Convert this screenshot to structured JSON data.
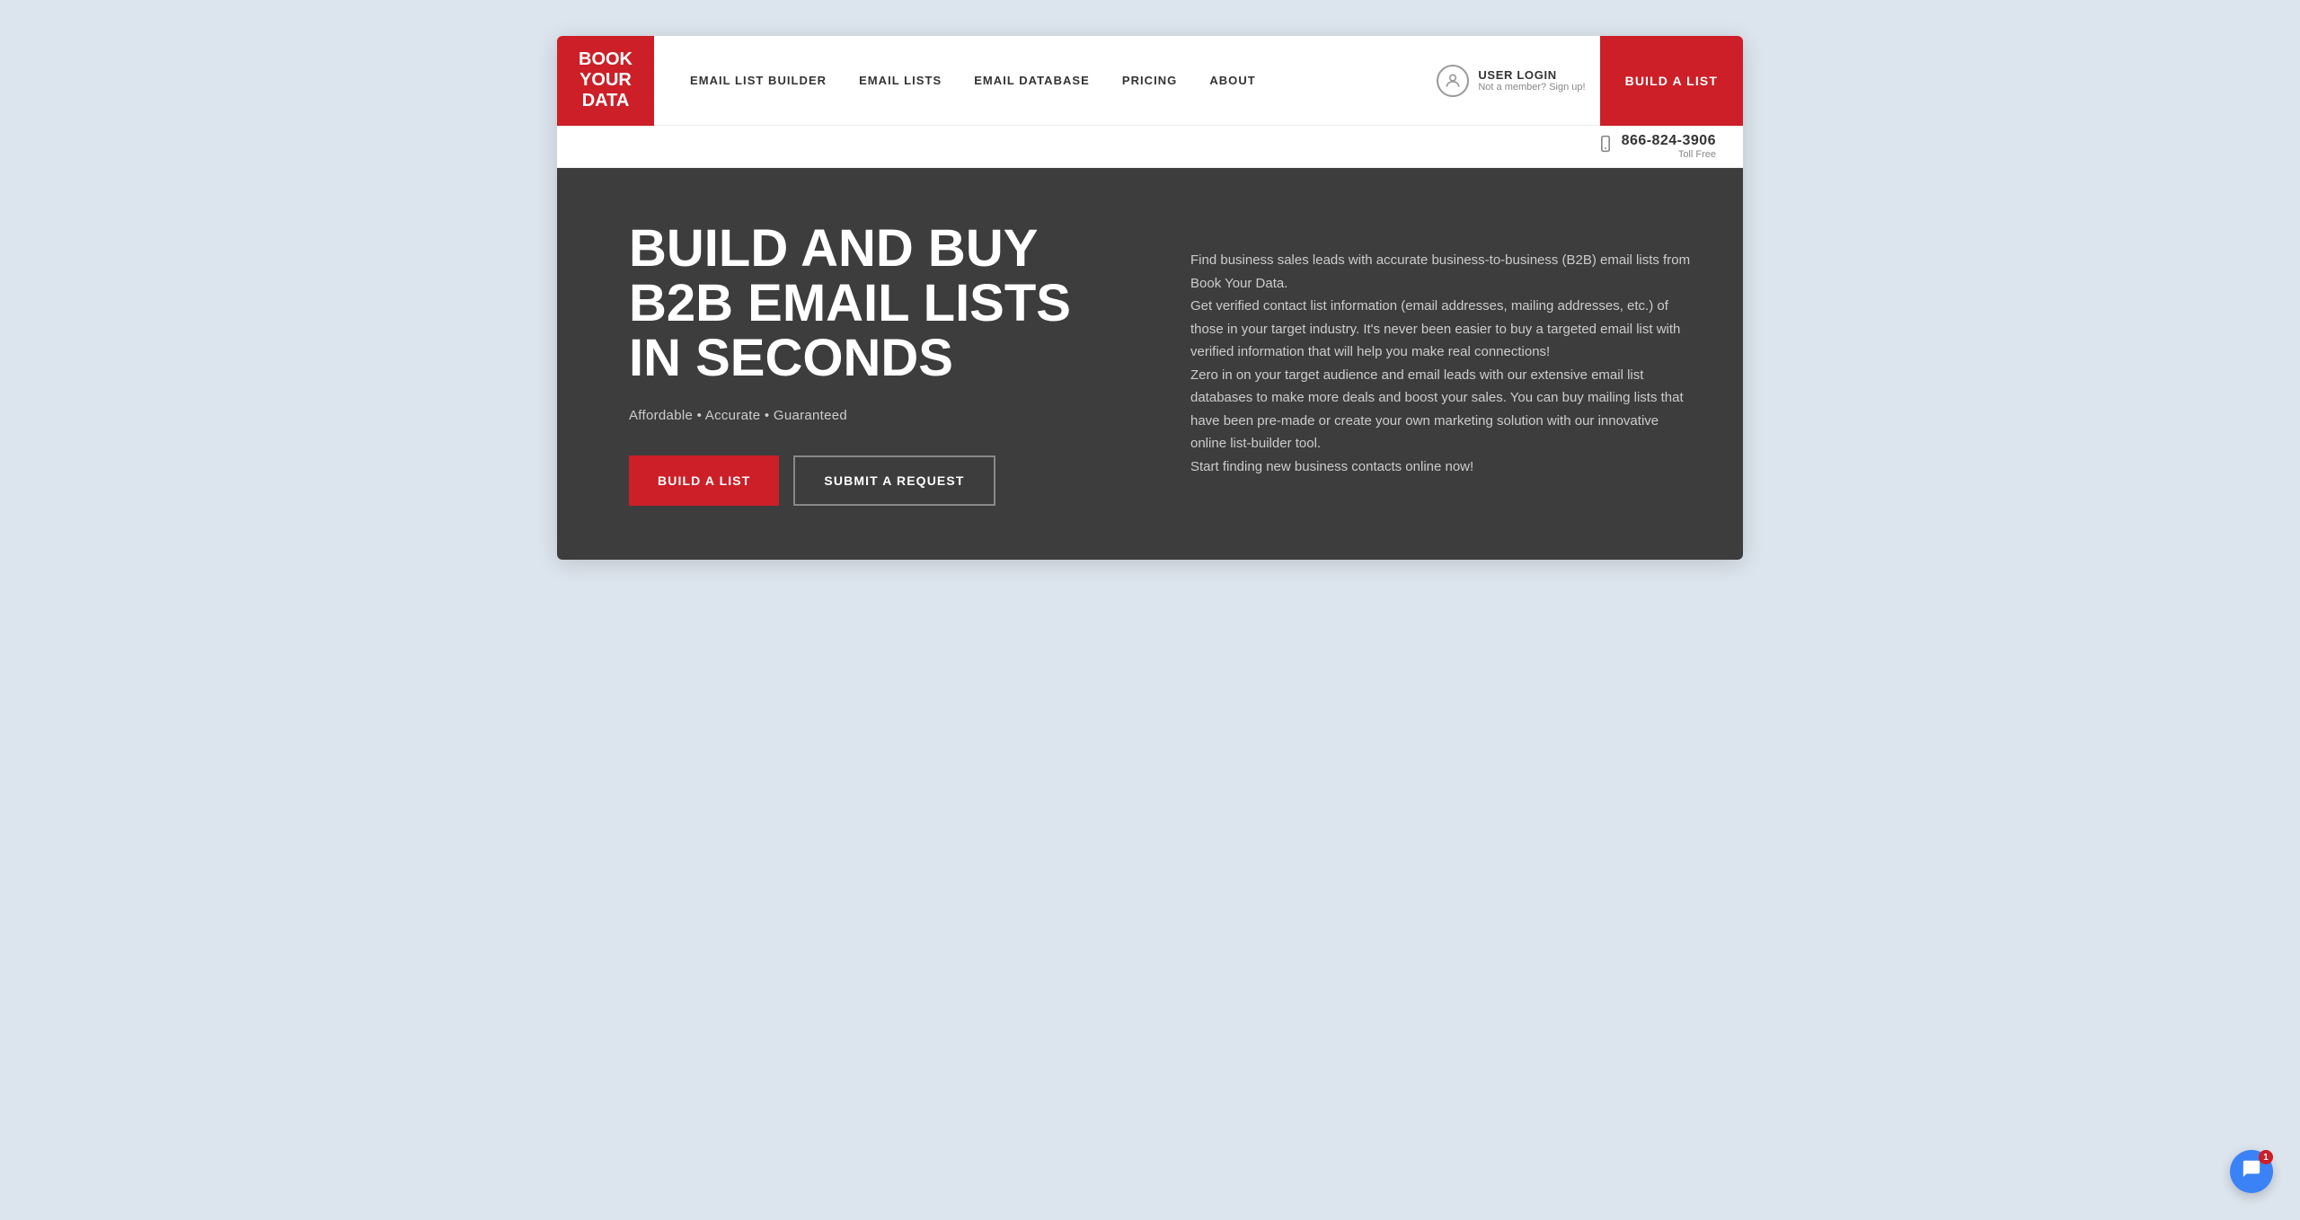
{
  "logo": {
    "line1": "BOOK",
    "line2": "YOUR",
    "line3": "DATA"
  },
  "nav": {
    "links": [
      {
        "id": "email-list-builder",
        "label": "EMAIL LIST BUILDER"
      },
      {
        "id": "email-lists",
        "label": "EMAIL LISTS"
      },
      {
        "id": "email-database",
        "label": "EMAIL DATABASE"
      },
      {
        "id": "pricing",
        "label": "PRICING"
      },
      {
        "id": "about",
        "label": "ABOUT"
      }
    ],
    "user_login_title": "USER LOGIN",
    "user_login_sub": "Not a member? Sign up!",
    "build_list_btn": "BUILD A LIST"
  },
  "phone": {
    "number": "866-824-3906",
    "label": "Toll Free"
  },
  "hero": {
    "title": "BUILD AND BUY\nB2B EMAIL LISTS\nIN SECONDS",
    "tagline_parts": [
      "Affordable",
      "•",
      "Accurate",
      "•",
      "Guaranteed"
    ],
    "tagline": "Affordable  •  Accurate  •  Guaranteed",
    "build_btn": "BUILD A LIST",
    "submit_btn": "SUBMIT A REQUEST",
    "description": "Find business sales leads with accurate business-to-business (B2B) email lists from Book Your Data.\nGet verified contact list information (email addresses, mailing addresses, etc.) of those in your target industry. It's never been easier to buy a targeted email list with verified information that will help you make real connections!\nZero in on your target audience and email leads with our extensive email list databases to make more deals and boost your sales. You can buy mailing lists that have been pre-made or create your own marketing solution with our innovative online list-builder tool.\nStart finding new business contacts online now!"
  },
  "chat": {
    "badge_count": "1"
  },
  "colors": {
    "brand_red": "#cc1f27",
    "hero_bg": "#3d3d3d",
    "page_bg": "#dce4ed"
  }
}
